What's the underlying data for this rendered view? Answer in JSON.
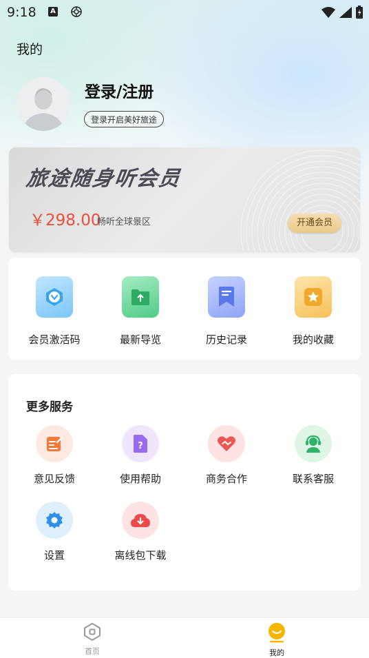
{
  "status_bar": {
    "time": "9:18"
  },
  "header": {
    "title": "我的"
  },
  "profile": {
    "login_label": "登录/注册",
    "login_subtitle": "登录开启美好旅途"
  },
  "vip": {
    "title": "旅途随身听会员",
    "price": "￥298.00",
    "description": "畅听全球景区",
    "button_label": "开通会员"
  },
  "quick_actions": [
    {
      "label": "会员激活码",
      "icon": "vip-code-icon",
      "color": "#4fb3f0"
    },
    {
      "label": "最新导览",
      "icon": "folder-icon",
      "color": "#3fbf78"
    },
    {
      "label": "历史记录",
      "icon": "history-icon",
      "color": "#6a86f2"
    },
    {
      "label": "我的收藏",
      "icon": "star-icon",
      "color": "#f5b640"
    }
  ],
  "services": {
    "title": "更多服务",
    "items": [
      {
        "label": "意见反馈",
        "icon": "feedback-icon",
        "color": "#f0803f"
      },
      {
        "label": "使用帮助",
        "icon": "help-icon",
        "color": "#9a6cf0"
      },
      {
        "label": "商务合作",
        "icon": "handshake-icon",
        "color": "#ee5a5a"
      },
      {
        "label": "联系客服",
        "icon": "customer-service-icon",
        "color": "#3fbf78"
      },
      {
        "label": "设置",
        "icon": "settings-icon",
        "color": "#2f8ee8"
      },
      {
        "label": "离线包下载",
        "icon": "download-icon",
        "color": "#ee4f4f"
      }
    ]
  },
  "tabbar": {
    "items": [
      {
        "label": "首页",
        "icon": "home-icon",
        "active": false
      },
      {
        "label": "我的",
        "icon": "profile-tab-icon",
        "active": true
      }
    ],
    "active_color": "#f7b500"
  }
}
